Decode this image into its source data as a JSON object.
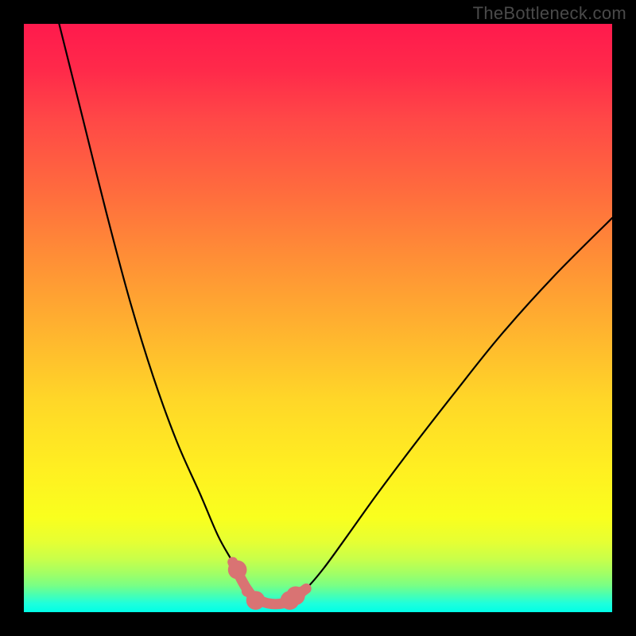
{
  "watermark": "TheBottleneck.com",
  "chart_data": {
    "type": "line",
    "title": "",
    "xlabel": "",
    "ylabel": "",
    "xlim": [
      0,
      100
    ],
    "ylim": [
      0,
      100
    ],
    "grid": false,
    "series": [
      {
        "name": "curve-left",
        "x": [
          6,
          10,
          14,
          18,
          22,
          26,
          30,
          33,
          35.5,
          37,
          38,
          39
        ],
        "values": [
          100,
          84,
          68,
          53,
          40,
          29,
          20,
          13,
          8.5,
          5.5,
          3.8,
          2.5
        ]
      },
      {
        "name": "curve-right",
        "x": [
          46,
          48,
          51,
          55,
          60,
          66,
          73,
          81,
          90,
          100
        ],
        "values": [
          2.5,
          4,
          7.5,
          13,
          20,
          28,
          37,
          47,
          57,
          67
        ]
      },
      {
        "name": "floor",
        "x": [
          39,
          41.5,
          44,
          46
        ],
        "values": [
          2.5,
          1.5,
          1.5,
          2.5
        ]
      }
    ],
    "markers": [
      {
        "name": "dot-left-upper",
        "x": 38,
        "y": 3.6,
        "r": 1.0
      },
      {
        "name": "dot-left-lower",
        "x": 39,
        "y": 2.5,
        "r": 1.0
      },
      {
        "name": "dot-right",
        "x": 47,
        "y": 3.3,
        "r": 1.0
      },
      {
        "name": "cap-left-top",
        "x": 36.3,
        "y": 7.2,
        "r": 1.6
      },
      {
        "name": "cap-left-bot",
        "x": 39.4,
        "y": 2.0,
        "r": 1.6
      },
      {
        "name": "cap-right-bot",
        "x": 45.2,
        "y": 2.0,
        "r": 1.6
      },
      {
        "name": "cap-right-top",
        "x": 46.2,
        "y": 2.8,
        "r": 1.6
      }
    ],
    "colors": {
      "curve": "#000000",
      "overlay": "#d97373"
    }
  }
}
